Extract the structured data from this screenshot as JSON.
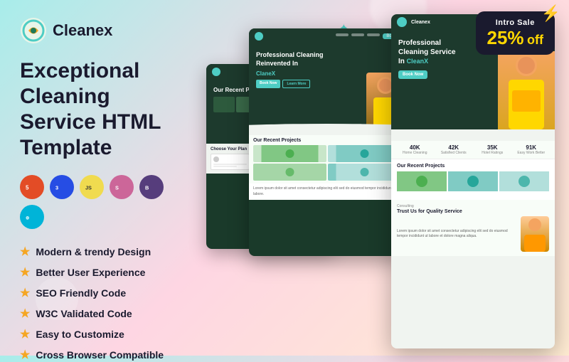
{
  "app": {
    "name": "Cleanex",
    "tagline": "Exceptional Cleaning Service HTML Template"
  },
  "sale_badge": {
    "intro": "Intro Sale",
    "percent": "25%",
    "off": "off"
  },
  "tech_badges": [
    "HTML5",
    "CSS3",
    "JS",
    "Sass",
    "Bootstrap",
    "Custom"
  ],
  "features": [
    "Modern & trendy Design",
    "Better User Experience",
    "SEO Friendly Code",
    "W3C Validated Code",
    "Easy to Customize",
    "Cross Browser Compatible"
  ],
  "screenshot_mid": {
    "hero_title": "Professional Cleaning Reinvented In ClaneX",
    "projects_title": "Our Recent Projects"
  },
  "screenshot_back": {
    "projects_title": "Our Recent Projects"
  },
  "screenshot_front": {
    "hero_title": "Professional Cleaning Service In",
    "hero_highlight": "CleanX",
    "stats": [
      {
        "num": "40K",
        "label": "Home Cleaning"
      },
      {
        "num": "42K",
        "label": "Satisfied Clients"
      },
      {
        "num": "35K",
        "label": "Hotel Ratings"
      },
      {
        "num": "91K",
        "label": "Easy Work Better"
      }
    ],
    "projects_title": "Our Recent Projects",
    "consulting_title": "Consulting",
    "consulting_sub": "Trust Us for Quality Service"
  },
  "sparkle_char": "✦",
  "watermark_char": "4"
}
